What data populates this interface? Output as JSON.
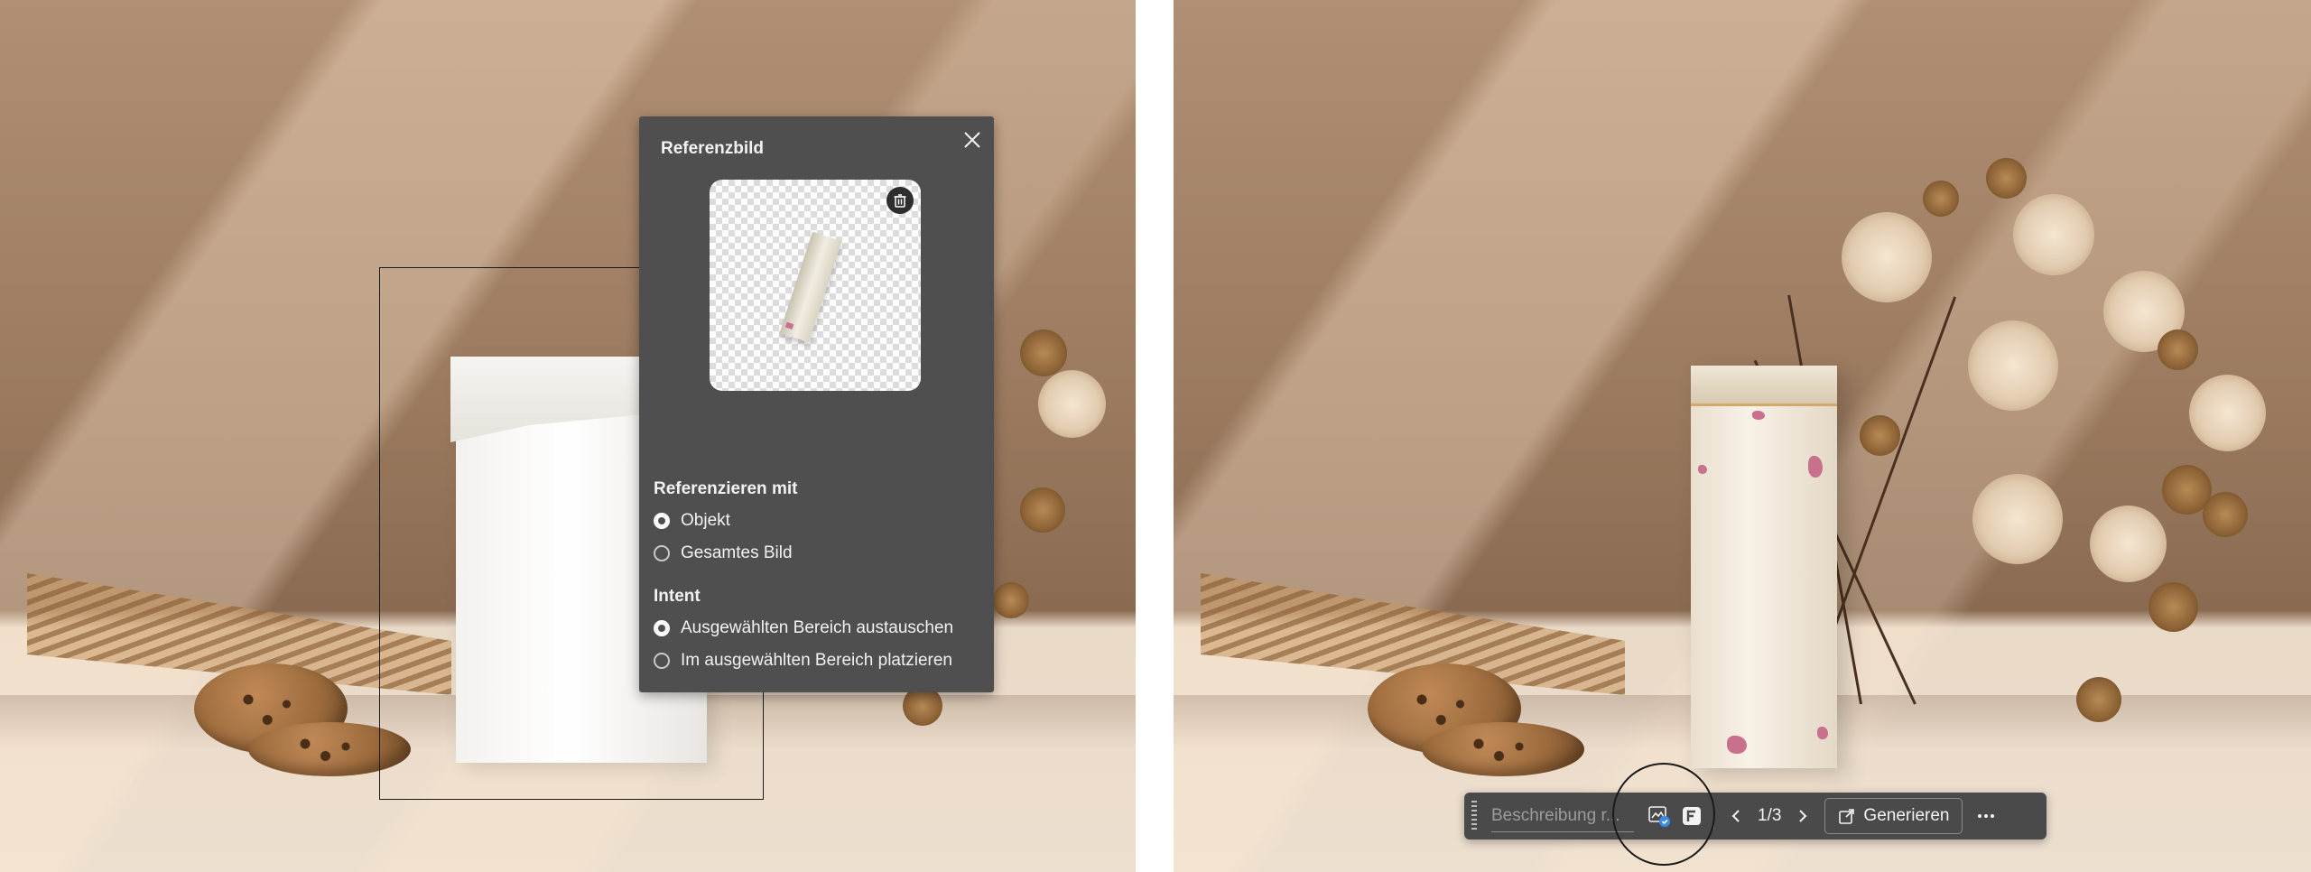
{
  "reference_panel": {
    "title": "Referenzbild",
    "reference_with": {
      "label": "Referenzieren mit",
      "options": [
        {
          "label": "Objekt",
          "checked": true
        },
        {
          "label": "Gesamtes Bild",
          "checked": false
        }
      ]
    },
    "intent": {
      "label": "Intent",
      "options": [
        {
          "label": "Ausgewählten Bereich austauschen",
          "checked": true
        },
        {
          "label": "Im ausgewählten Bereich platzieren",
          "checked": false
        }
      ]
    }
  },
  "taskbar": {
    "description_placeholder": "Beschreibung r...",
    "pager": "1/3",
    "generate_label": "Generieren"
  },
  "colors": {
    "panel_bg": "#4f4f4f",
    "taskbar_bg": "#4a4a4a",
    "accent_blue": "#3b8be6"
  }
}
